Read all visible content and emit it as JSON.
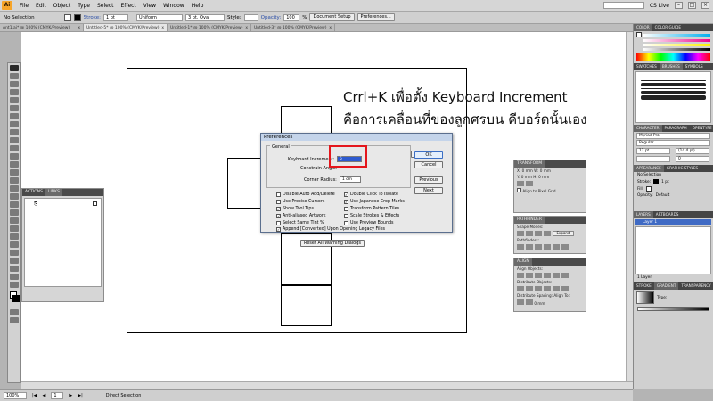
{
  "menubar": {
    "app_badge": "Ai",
    "items": [
      "File",
      "Edit",
      "Object",
      "Type",
      "Select",
      "Effect",
      "View",
      "Window",
      "Help"
    ],
    "workspace": "CS Live"
  },
  "control": {
    "selection": "No Selection",
    "stroke_label": "Stroke:",
    "stroke_value": "1 pt",
    "dash_value": "Uniform",
    "brush_value": "3 pt. Oval",
    "style_label": "Style:",
    "opacity_label": "Opacity:",
    "opacity_value": "100",
    "opacity_unit": "%",
    "doc_setup": "Document Setup",
    "preferences": "Preferences..."
  },
  "doc_tabs": [
    {
      "label": "Ant1.ai* @ 100% (CMYK/Preview)",
      "close": "x"
    },
    {
      "label": "Untitled-5* @ 100% (CMYK/Preview)",
      "close": "x"
    },
    {
      "label": "Untitled-1* @ 100% (CMYK/Preview)",
      "close": "x"
    },
    {
      "label": "Untitled-3* @ 100% (CMYK/Preview)",
      "close": "x"
    }
  ],
  "instruction": {
    "line1": "Crrl+K เพื่อตั้ง Keyboard Increment",
    "line2": "คือการเคลื่อนที่ของลูกศรบน คีบอร์ดนั้นเอง"
  },
  "actions_panel": {
    "tabs": [
      "ACTIONS",
      "LINKS"
    ]
  },
  "dialog": {
    "title": "Preferences",
    "section": "General",
    "keyboard_increment_label": "Keyboard Increment:",
    "keyboard_increment_value": "5",
    "constrain_angle_label": "Constrain Angle:",
    "corner_radius_label": "Corner Radius:",
    "corner_radius_value": "1 cm",
    "checkboxes_left": [
      {
        "label": "Disable Auto Add/Delete",
        "checked": false
      },
      {
        "label": "Use Precise Cursors",
        "checked": false
      },
      {
        "label": "Show Tool Tips",
        "checked": true
      },
      {
        "label": "Anti-aliased Artwork",
        "checked": true
      },
      {
        "label": "Select Same Tint %",
        "checked": false
      }
    ],
    "checkboxes_right": [
      {
        "label": "Double Click To Isolate",
        "checked": true
      },
      {
        "label": "Use Japanese Crop Marks",
        "checked": true
      },
      {
        "label": "Transform Pattern Tiles",
        "checked": false
      },
      {
        "label": "Scale Strokes & Effects",
        "checked": false
      },
      {
        "label": "Use Preview Bounds",
        "checked": false
      }
    ],
    "legacy_checkbox": {
      "label": "Append [Converted] Upon Opening Legacy Files",
      "checked": true
    },
    "reset_warnings": "Reset All Warning Dialogs",
    "buttons": {
      "ok": "OK",
      "cancel": "Cancel",
      "previous": "Previous",
      "next": "Next"
    }
  },
  "transform_panel": {
    "title": "TRANSFORM",
    "x_label": "X:",
    "x_value": "0 mm",
    "y_label": "Y:",
    "y_value": "0 mm",
    "w_label": "W:",
    "w_value": "0 mm",
    "h_label": "H:",
    "h_value": "0 mm",
    "align_pixel": "Align to Pixel Grid"
  },
  "pathfinder_panel": {
    "title": "PATHFINDER",
    "shape_modes": "Shape Modes:",
    "expand": "Expand",
    "pathfinders": "Pathfinders:"
  },
  "align_panel": {
    "title": "ALIGN",
    "align_objects": "Align Objects:",
    "distribute_objects": "Distribute Objects:",
    "distribute_spacing": "Distribute Spacing:",
    "align_to": "Align To:",
    "spacing_value": "0 mm"
  },
  "dock": {
    "color_tabs": [
      "COLOR",
      "COLOR GUIDE"
    ],
    "swatch_tabs": [
      "SWATCHES",
      "BRUSHES",
      "SYMBOLS"
    ],
    "character_tabs": [
      "CHARACTER",
      "PARAGRAPH",
      "OPENTYPE"
    ],
    "font_family": "Myriad Pro",
    "font_style": "Regular",
    "font_size": "12 pt",
    "leading": "(14.4 pt)",
    "tracking": "0",
    "appearance_tabs": [
      "APPEARANCE",
      "GRAPHIC STYLES"
    ],
    "appearance_selection": "No Selection",
    "appearance_stroke": "Stroke:",
    "appearance_stroke_value": "1 pt",
    "appearance_fill": "Fill:",
    "appearance_opacity": "Opacity:",
    "appearance_opacity_value": "Default",
    "layers_tabs": [
      "LAYERS",
      "ARTBOARDS"
    ],
    "layer_name": "Layer 1",
    "layer_count": "1 Layer",
    "gradient_tabs": [
      "STROKE",
      "GRADIENT",
      "TRANSPARENCY"
    ],
    "gradient_type": "Type:"
  },
  "status": {
    "zoom": "100%",
    "page": "1",
    "tool": "Direct Selection"
  },
  "colors": {
    "highlight": "#e4161c",
    "selection_blue": "#2d5ad0"
  }
}
